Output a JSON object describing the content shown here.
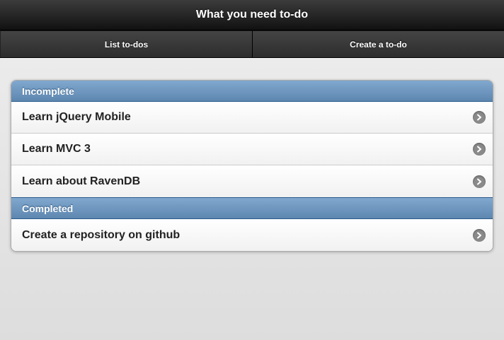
{
  "header": {
    "title": "What you need to-do"
  },
  "navbar": {
    "items": [
      {
        "label": "List to-dos"
      },
      {
        "label": "Create a to-do"
      }
    ]
  },
  "list": {
    "incomplete": {
      "label": "Incomplete",
      "items": [
        {
          "label": "Learn jQuery Mobile",
          "icon": "arrow-right-icon"
        },
        {
          "label": "Learn MVC 3",
          "icon": "arrow-right-icon"
        },
        {
          "label": "Learn about RavenDB",
          "icon": "arrow-right-icon"
        }
      ]
    },
    "completed": {
      "label": "Completed",
      "items": [
        {
          "label": "Create a repository on github",
          "icon": "arrow-right-icon"
        }
      ]
    }
  },
  "colors": {
    "header_bg": "#1f1f1f",
    "divider_bg": "#6c95bf",
    "page_bg": "#e5e5e5",
    "icon_bg": "#8a8a8a"
  }
}
